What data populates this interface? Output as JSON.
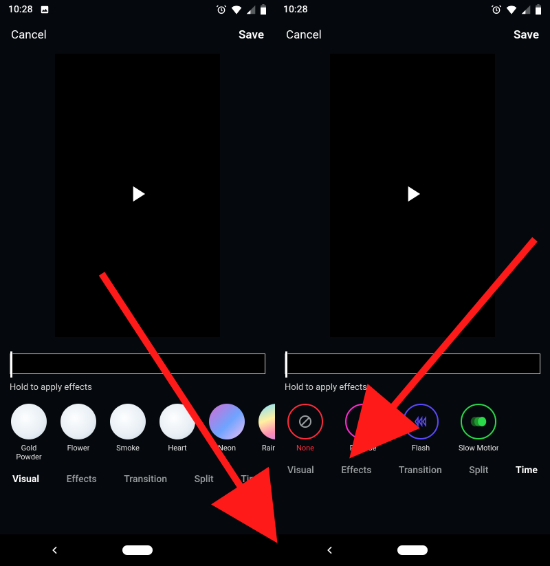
{
  "status": {
    "time": "10:28"
  },
  "header": {
    "cancel": "Cancel",
    "save": "Save"
  },
  "hold_text": "Hold to apply effects",
  "left": {
    "effects": [
      {
        "label": "Gold Powder"
      },
      {
        "label": "Flower"
      },
      {
        "label": "Smoke"
      },
      {
        "label": "Heart"
      },
      {
        "label": "Neon"
      },
      {
        "label": "Rainbow"
      }
    ],
    "tabs": {
      "visual": "Visual",
      "effects": "Effects",
      "transition": "Transition",
      "split": "Split",
      "time": "Time"
    }
  },
  "right": {
    "effects": [
      {
        "label": "None",
        "color": "#ff2b3a"
      },
      {
        "label": "Reverse",
        "color": "#ff2bd0"
      },
      {
        "label": "Flash",
        "color": "#5b49ff"
      },
      {
        "label": "Slow Motion",
        "color": "#2bd94a"
      }
    ],
    "tabs": {
      "visual": "Visual",
      "effects": "Effects",
      "transition": "Transition",
      "split": "Split",
      "time": "Time"
    }
  }
}
